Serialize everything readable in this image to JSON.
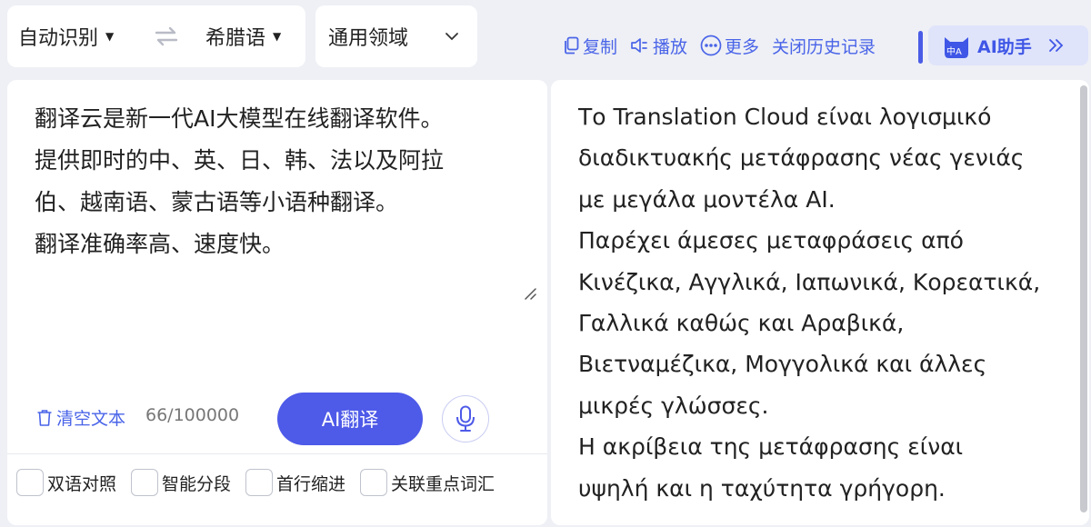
{
  "lang": {
    "source": "自动识别",
    "target": "希腊语"
  },
  "domain": {
    "selected": "通用领域"
  },
  "toolbar": {
    "copy": "复制",
    "play": "播放",
    "more": "更多",
    "close_history": "关闭历史记录",
    "ai_assistant": "AI助手",
    "ai_badge": "中A"
  },
  "source": {
    "lines": [
      "翻译云是新一代AI大模型在线翻译软件。",
      "提供即时的中、英、日、韩、法以及阿拉",
      "伯、越南语、蒙古语等小语种翻译。",
      "翻译准确率高、速度快。"
    ],
    "clear": "清空文本",
    "count": "66/100000",
    "translate": "AI翻译"
  },
  "options": [
    "双语对照",
    "智能分段",
    "首行缩进",
    "关联重点词汇"
  ],
  "target": {
    "lines": [
      "Το Translation Cloud είναι λογισμικό",
      "διαδικτυακής μετάφρασης νέας γενιάς",
      "με μεγάλα μοντέλα AI.",
      "Παρέχει άμεσες μεταφράσεις από",
      "Κινέζικα, Αγγλικά, Ιαπωνικά, Κορεατικά,",
      "Γαλλικά καθώς και Αραβικά,",
      "Βιετναμέζικα, Μογγολικά και άλλες",
      "μικρές γλώσσες.",
      "Η ακρίβεια της μετάφρασης είναι",
      "υψηλή και η ταχύτητα γρήγορη."
    ]
  },
  "colors": {
    "accent": "#4e5ae8",
    "link": "#4a64e8",
    "background": "#eef0f5"
  }
}
